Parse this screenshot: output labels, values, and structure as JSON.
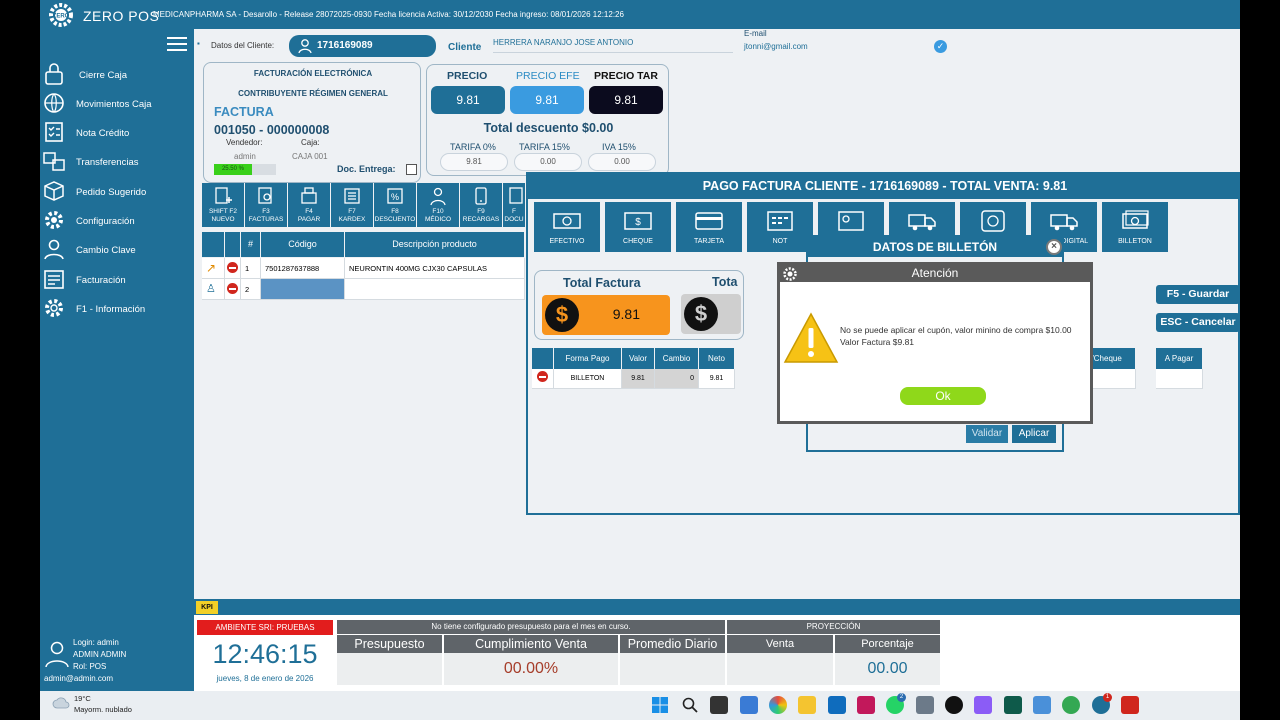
{
  "topbar": {
    "brand": "ZERO POS",
    "info": "MEDICANPHARMA SA - Desarollo - Release 28072025-0930 Fecha licencia Activa: 30/12/2030 Fecha ingreso: 08/01/2026 12:12:26"
  },
  "sidebar": {
    "items": [
      {
        "label": "Cierre Caja",
        "icon": "lock-icon"
      },
      {
        "label": "Movimientos Caja",
        "icon": "world-icon"
      },
      {
        "label": "Nota Crédito",
        "icon": "checklist-icon"
      },
      {
        "label": "Transferencias",
        "icon": "transfer-icon"
      },
      {
        "label": "Pedido Sugerido",
        "icon": "box-icon"
      },
      {
        "label": "Configuración",
        "icon": "gear-icon"
      },
      {
        "label": "Cambio Clave",
        "icon": "user-icon"
      },
      {
        "label": "Facturación",
        "icon": "invoice-icon"
      },
      {
        "label": "F1 - Información",
        "icon": "info-icon"
      }
    ],
    "user": {
      "login": "Login:  admin",
      "name": "ADMIN ADMIN",
      "rol": "Rol:    POS",
      "email": "admin@admin.com"
    }
  },
  "client": {
    "label": "Datos del Cliente:",
    "id": "1716169089",
    "cliente_label": "Cliente",
    "name": "HERRERA NARANJO JOSE ANTONIO",
    "email_label": "E-mail",
    "email": "jtonni@gmail.com"
  },
  "factura": {
    "title1": "FACTURACIÓN ELECTRÓNICA",
    "title2": "CONTRIBUYENTE RÉGIMEN GENERAL",
    "label": "FACTURA",
    "number": "001050 - 000000008",
    "vendedor_label": "Vendedor:",
    "vendedor": "admin",
    "caja_label": "Caja:",
    "caja": "CAJA 001",
    "progress_text": "25.50 %",
    "progress": 0.255,
    "doc_entrega": "Doc. Entrega:"
  },
  "prices": {
    "precio_label": "PRECIO",
    "precio": "9.81",
    "efe_label": "PRECIO EFE",
    "efe": "9.81",
    "tar_label": "PRECIO TAR",
    "tar": "9.81",
    "total_desc": "Total descuento $0.00",
    "tarifa0_label": "TARIFA 0%",
    "tarifa0": "9.81",
    "tarifa15_label": "TARIFA 15%",
    "tarifa15": "0.00",
    "iva_label": "IVA 15%",
    "iva": "0.00"
  },
  "toolbar": [
    {
      "label": "SHIFT F2\nNUEVO"
    },
    {
      "label": "F3\nFACTURAS"
    },
    {
      "label": "F4\nPAGAR"
    },
    {
      "label": "F7\nKARDEX"
    },
    {
      "label": "F8\nDESCUENTO"
    },
    {
      "label": "F10\nMÉDICO"
    },
    {
      "label": "F9\nRECARGAS"
    },
    {
      "label": "F\nDOCU"
    }
  ],
  "grid": {
    "headers": {
      "num": "#",
      "codigo": "Código",
      "desc": "Descripción producto"
    },
    "rows": [
      {
        "num": "1",
        "codigo": "7501287637888",
        "desc": "NEURONTIN 400MG CJX30 CAPSULAS"
      },
      {
        "num": "2",
        "codigo": "",
        "desc": ""
      }
    ]
  },
  "pago": {
    "title": "PAGO FACTURA CLIENTE - 1716169089 - TOTAL VENTA: 9.81",
    "methods": [
      {
        "label": "EFECTIVO"
      },
      {
        "label": "CHEQUE"
      },
      {
        "label": "TARJETA"
      },
      {
        "label": "NOT"
      },
      {
        "label": ""
      },
      {
        "label": ""
      },
      {
        "label": ""
      },
      {
        "label": "PAGO DIGITAL"
      },
      {
        "label": "BILLETON"
      }
    ],
    "total_factura_label": "Total Factura",
    "total_factura": "9.81",
    "total2_label": "Tota",
    "guardar": "F5 - Guardar",
    "cancelar": "ESC - Cancelar",
    "headers": {
      "forma": "Forma Pago",
      "valor": "Valor",
      "cambio": "Cambio",
      "neto": "Neto",
      "voucher": "Voucher/Cheque",
      "apagar": "A Pagar"
    },
    "row": {
      "forma": "BILLETON",
      "valor": "9.81",
      "cambio": "0",
      "neto": "9.81"
    }
  },
  "billeton": {
    "title": "DATOS DE BILLETÓN",
    "validar": "Validar",
    "aplicar": "Aplicar"
  },
  "alert": {
    "title": "Atención",
    "message": "No se puede aplicar el cupón, valor minino de compra $10.00 Valor Factura $9.81",
    "ok": "Ok"
  },
  "kpi": {
    "tab": "KPI",
    "ambiente": "AMBIENTE SRI: PRUEBAS",
    "clock": "12:46:15",
    "date": "jueves, 8 de enero de 2026",
    "presupuesto_msg": "No tiene configurado presupuesto para el mes en curso.",
    "presupuesto": "Presupuesto",
    "cumplimiento": "Cumplimiento Venta",
    "cumplimiento_val": "00.00%",
    "promedio": "Promedio Diario",
    "proyeccion": "PROYECCIÓN",
    "venta": "Venta",
    "porcentaje": "Porcentaje",
    "porcentaje_val": "00.00"
  },
  "taskbar": {
    "temp": "19°C",
    "weather": "Mayorm. nublado",
    "badge1": "2",
    "badge2": "1"
  }
}
